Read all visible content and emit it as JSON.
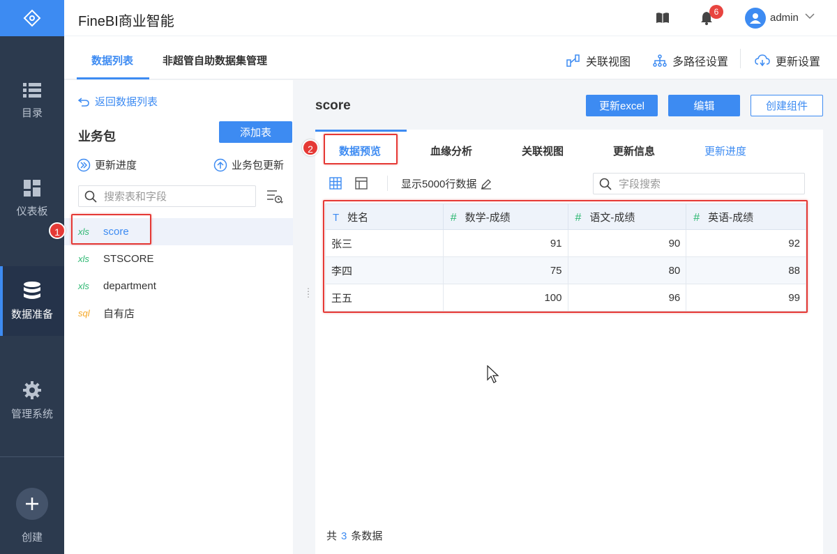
{
  "app": {
    "title": "FineBI商业智能"
  },
  "nav": {
    "items": [
      {
        "label": "目录",
        "icon": "list-icon"
      },
      {
        "label": "仪表板",
        "icon": "dashboard-icon"
      },
      {
        "label": "数据准备",
        "icon": "database-icon"
      },
      {
        "label": "管理系统",
        "icon": "gear-icon"
      }
    ],
    "create_label": "创建"
  },
  "header": {
    "notification_count": "6",
    "user": "admin"
  },
  "top_tabs": {
    "tab1": "数据列表",
    "tab2": "非超管自助数据集管理",
    "actions": [
      "关联视图",
      "多路径设置",
      "更新设置"
    ]
  },
  "left": {
    "back": "返回数据列表",
    "package_title": "业务包",
    "add_table": "添加表",
    "update_progress": "更新进度",
    "package_update": "业务包更新",
    "search_placeholder": "搜索表和字段",
    "tables": [
      {
        "type": "xls",
        "name": "score"
      },
      {
        "type": "xls",
        "name": "STSCORE"
      },
      {
        "type": "xls",
        "name": "department"
      },
      {
        "type": "sql",
        "name": "自有店"
      }
    ]
  },
  "main": {
    "table_name": "score",
    "buttons": {
      "update_excel": "更新excel",
      "edit": "编辑",
      "create_component": "创建组件"
    },
    "subtabs": [
      "数据预览",
      "血缘分析",
      "关联视图",
      "更新信息",
      "更新进度"
    ],
    "rows_label": "显示5000行数据",
    "field_search_placeholder": "字段搜索",
    "columns": [
      {
        "type": "T",
        "name": "姓名"
      },
      {
        "type": "#",
        "name": "数学-成绩"
      },
      {
        "type": "#",
        "name": "语文-成绩"
      },
      {
        "type": "#",
        "name": "英语-成绩"
      }
    ],
    "rows": [
      [
        "张三",
        "91",
        "90",
        "92"
      ],
      [
        "李四",
        "75",
        "80",
        "88"
      ],
      [
        "王五",
        "100",
        "96",
        "99"
      ]
    ],
    "footer": {
      "prefix": "共",
      "count": "3",
      "suffix": "条数据"
    }
  },
  "annotations": {
    "marker1": "1",
    "marker2": "2"
  },
  "colors": {
    "accent": "#3d8bf2",
    "nav_bg": "#2c3a4e",
    "highlight": "#e53935"
  }
}
